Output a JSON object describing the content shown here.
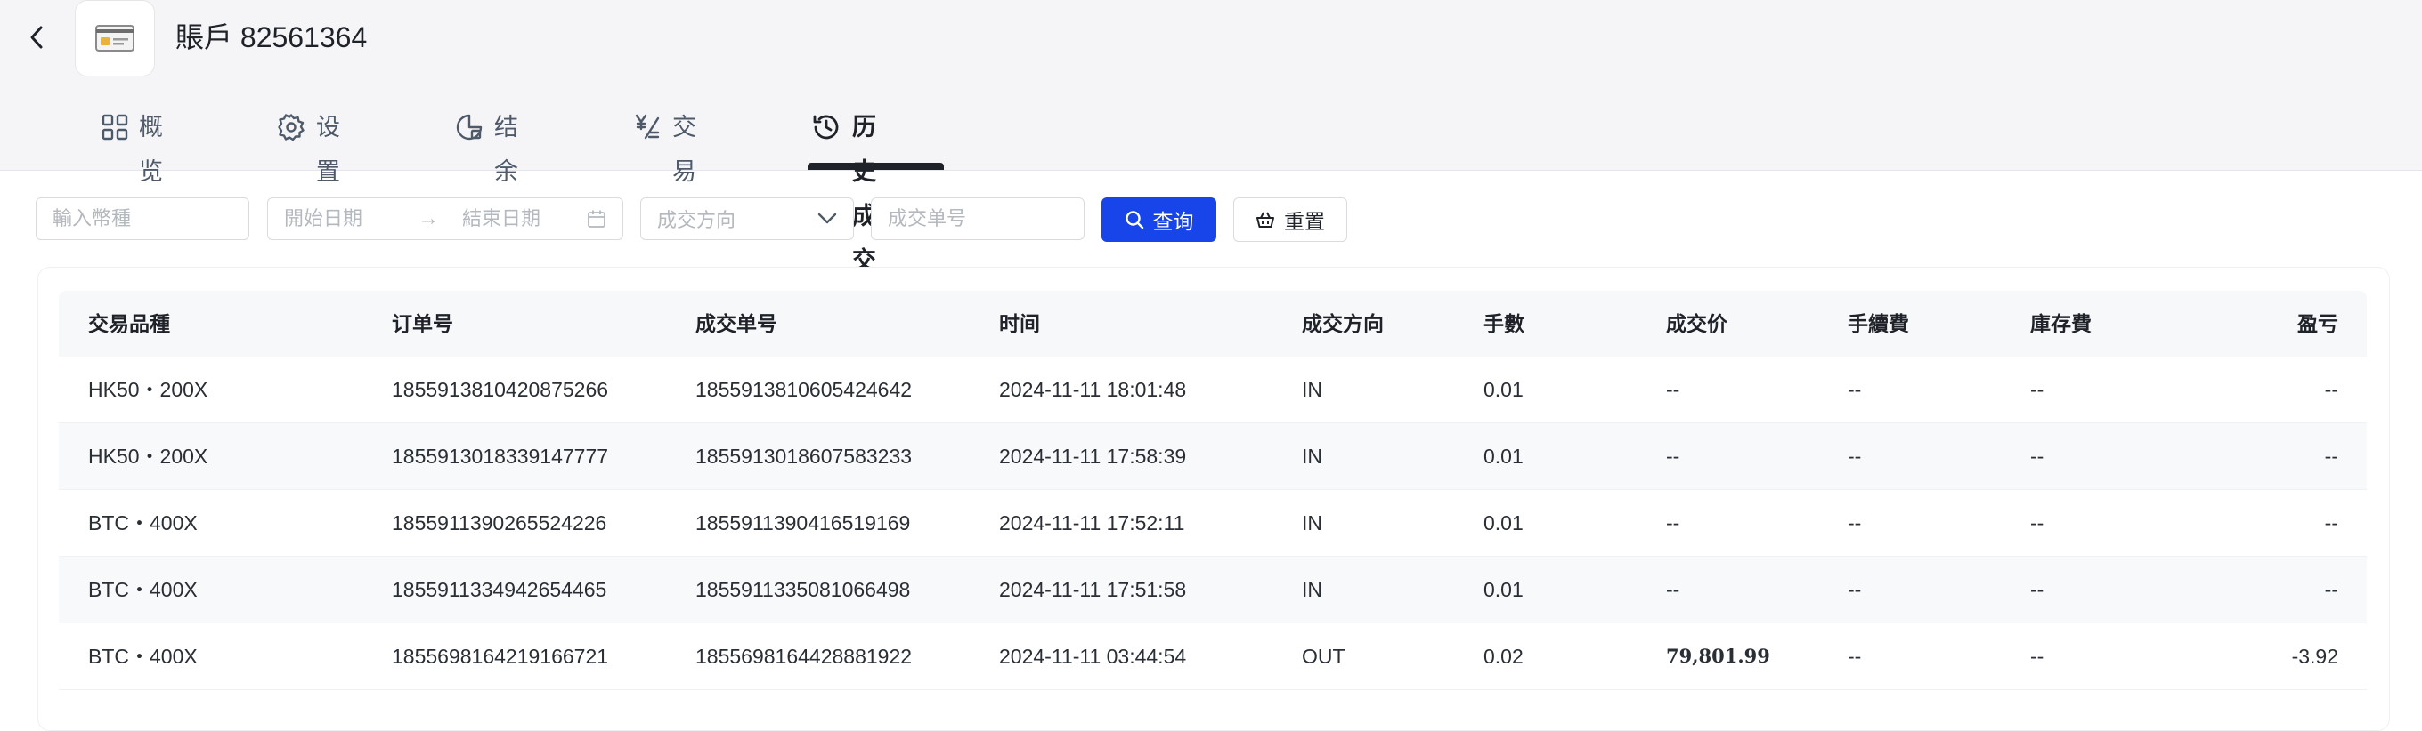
{
  "account": {
    "title": "賬戶 82561364"
  },
  "tabs": [
    {
      "label": "概览",
      "icon": "grid-icon"
    },
    {
      "label": "设置",
      "icon": "gear-icon"
    },
    {
      "label": "结余",
      "icon": "balance-icon"
    },
    {
      "label": "交易",
      "icon": "exchange-icon"
    },
    {
      "label": "历史成交",
      "icon": "history-icon",
      "active": true
    }
  ],
  "filters": {
    "symbol_placeholder": "輸入幣種",
    "start_date_placeholder": "開始日期",
    "end_date_placeholder": "結束日期",
    "direction_placeholder": "成交方向",
    "deal_no_placeholder": "成交单号",
    "query_label": "查询",
    "reset_label": "重置"
  },
  "table": {
    "columns": [
      "交易品種",
      "订单号",
      "成交单号",
      "时间",
      "成交方向",
      "手數",
      "成交价",
      "手續費",
      "庫存費",
      "盈亏"
    ],
    "rows": [
      [
        "HK50・200X",
        "1855913810420875266",
        "1855913810605424642",
        "2024-11-11 18:01:48",
        "IN",
        "0.01",
        "--",
        "--",
        "--",
        "--"
      ],
      [
        "HK50・200X",
        "1855913018339147777",
        "1855913018607583233",
        "2024-11-11 17:58:39",
        "IN",
        "0.01",
        "--",
        "--",
        "--",
        "--"
      ],
      [
        "BTC・400X",
        "1855911390265524226",
        "1855911390416519169",
        "2024-11-11 17:52:11",
        "IN",
        "0.01",
        "--",
        "--",
        "--",
        "--"
      ],
      [
        "BTC・400X",
        "1855911334942654465",
        "1855911335081066498",
        "2024-11-11 17:51:58",
        "IN",
        "0.01",
        "--",
        "--",
        "--",
        "--"
      ],
      [
        "BTC・400X",
        "1855698164219166721",
        "1855698164428881922",
        "2024-11-11 03:44:54",
        "OUT",
        "0.02",
        "79,801.99",
        "--",
        "--",
        "-3.92"
      ]
    ]
  },
  "colors": {
    "primary": "#1745ea",
    "negative": "#d6332f",
    "text": "#1f2329"
  }
}
